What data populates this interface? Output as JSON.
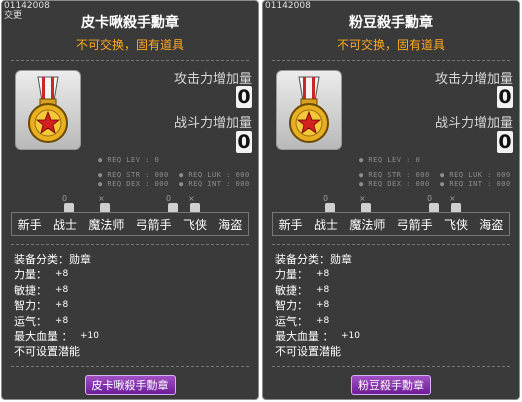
{
  "tooltips": [
    {
      "item_id": "01142008",
      "flag": "交更",
      "title": "皮卡啾殺手勳章",
      "subtitle": "不可交换，固有道具",
      "attack_label": "攻击力增加量",
      "attack_value": "0",
      "combat_label": "战斗力增加量",
      "combat_value": "0",
      "req_lev": "● REQ LEV :    0",
      "req_str": "● REQ STR : 000",
      "req_luk": "● REQ LUK : 000",
      "req_dex": "● REQ DEX : 000",
      "req_int": "● REQ INT : 000",
      "job_flags": [
        "0",
        "×",
        "0",
        "×"
      ],
      "jobs": [
        "新手",
        "战士",
        "魔法师",
        "弓箭手",
        "飞侠",
        "海盗"
      ],
      "attrs": {
        "category_label": "装备分类：",
        "category_value": "勋章",
        "str_label": "力量：",
        "str_value": "+8",
        "dex_label": "敏捷：",
        "dex_value": "+8",
        "int_label": "智力：",
        "int_value": "+8",
        "luk_label": "运气：",
        "luk_value": "+8",
        "hp_label": "最大血量 ：",
        "hp_value": "+10",
        "potential": "不可设置潜能"
      },
      "name_tag": "皮卡啾殺手勳章"
    },
    {
      "item_id": "01142008",
      "flag": "",
      "title": "粉豆殺手勳章",
      "subtitle": "不可交换，固有道具",
      "attack_label": "攻击力增加量",
      "attack_value": "0",
      "combat_label": "战斗力增加量",
      "combat_value": "0",
      "req_lev": "● REQ LEV :    0",
      "req_str": "● REQ STR : 000",
      "req_luk": "● REQ LUK : 000",
      "req_dex": "● REQ DEX : 000",
      "req_int": "● REQ INT : 000",
      "job_flags": [
        "0",
        "×",
        "0",
        "×"
      ],
      "jobs": [
        "新手",
        "战士",
        "魔法师",
        "弓箭手",
        "飞侠",
        "海盗"
      ],
      "attrs": {
        "category_label": "装备分类：",
        "category_value": "勋章",
        "str_label": "力量：",
        "str_value": "+8",
        "dex_label": "敏捷：",
        "dex_value": "+8",
        "int_label": "智力：",
        "int_value": "+8",
        "luk_label": "运气：",
        "luk_value": "+8",
        "hp_label": "最大血量 ：",
        "hp_value": "+10",
        "potential": "不可设置潜能"
      },
      "name_tag": "粉豆殺手勳章"
    }
  ],
  "colors": {
    "background": "#3a3a3a",
    "subtitle": "#ffaa22",
    "name_tag": "#8a35b5",
    "medal_gold": "#e8b020",
    "medal_star": "#d42020"
  },
  "icons": [
    "medal-icon",
    "job-flag-icon"
  ]
}
